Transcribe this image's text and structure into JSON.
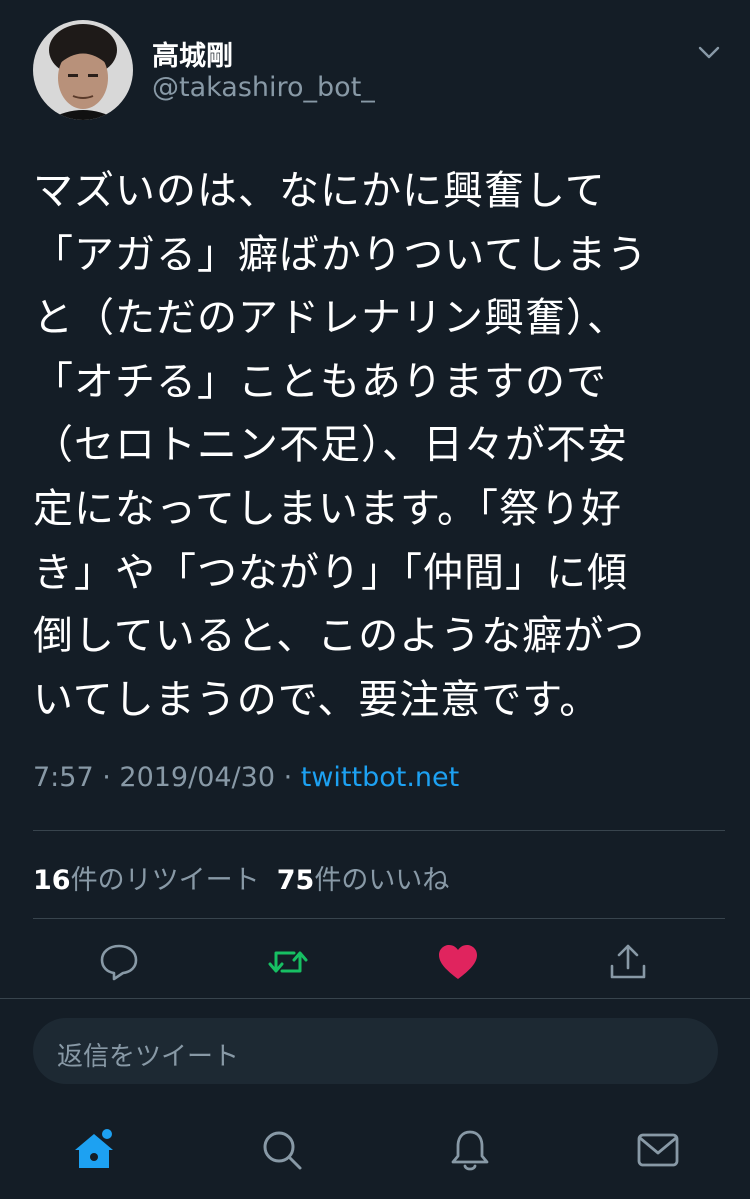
{
  "user": {
    "display_name": "高城剛",
    "handle": "@takashiro_bot_"
  },
  "tweet": {
    "lines": [
      "マズいのは、なにかに興奮して",
      "「アガる」癖ばかりついてしまう",
      "と（ただのアドレナリン興奮）、",
      "「オチる」こともありますので",
      "（セロトニン不足）、日々が不安",
      "定になってしまいます。「祭り好",
      "き」や「つながり」「仲間」に傾",
      "倒していると、このような癖がつ",
      "いてしまうので、要注意です。"
    ],
    "time": "7:57",
    "date": "2019/04/30",
    "source": "twittbot.net"
  },
  "stats": {
    "retweets_count": "16",
    "retweets_label": "件のリツイート",
    "likes_count": "75",
    "likes_label": "件のいいね"
  },
  "reply": {
    "placeholder": "返信をツイート"
  },
  "icons": {
    "reply": "reply-icon",
    "retweet": "retweet-icon",
    "like": "heart-icon",
    "share": "share-icon",
    "home": "home-icon",
    "search": "search-icon",
    "notifications": "bell-icon",
    "messages": "mail-icon",
    "more": "chevron-down-icon"
  },
  "colors": {
    "background": "#141d26",
    "accent": "#1da1f2",
    "retweet": "#17bf63",
    "like": "#e0245e",
    "muted": "#8899a6"
  }
}
